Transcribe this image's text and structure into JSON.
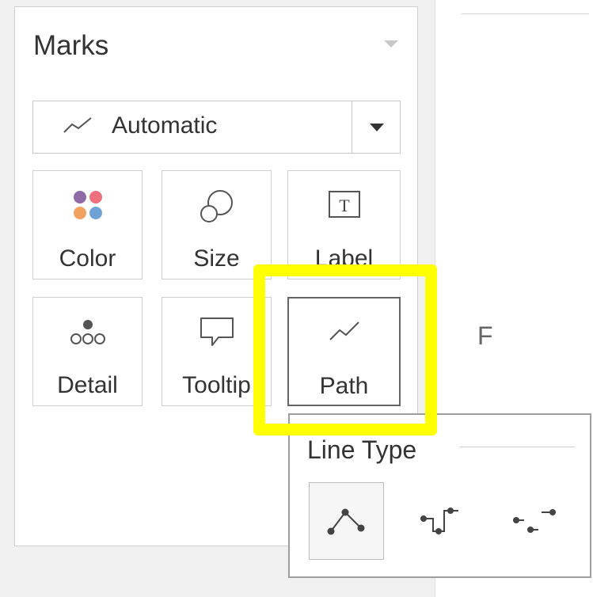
{
  "marks": {
    "title": "Marks",
    "mark_type": {
      "selected": "Automatic",
      "icon": "line-chart-icon"
    },
    "cards": [
      {
        "label": "Color",
        "icon": "color-dots-icon"
      },
      {
        "label": "Size",
        "icon": "size-icon"
      },
      {
        "label": "Label",
        "icon": "text-label-icon"
      },
      {
        "label": "Detail",
        "icon": "detail-icon"
      },
      {
        "label": "Tooltip",
        "icon": "tooltip-icon"
      },
      {
        "label": "Path",
        "icon": "path-icon"
      }
    ]
  },
  "background_text": "F",
  "line_type_popup": {
    "title": "Line Type",
    "options": [
      {
        "name": "linear",
        "icon": "linear-line-icon",
        "selected": true
      },
      {
        "name": "step",
        "icon": "step-line-icon",
        "selected": false
      },
      {
        "name": "jump",
        "icon": "jump-line-icon",
        "selected": false
      }
    ]
  },
  "colors": {
    "highlight": "#ffff00",
    "color_dots": [
      "#8e6aa6",
      "#ee6f7d",
      "#f1a261",
      "#6fa3d8"
    ]
  }
}
